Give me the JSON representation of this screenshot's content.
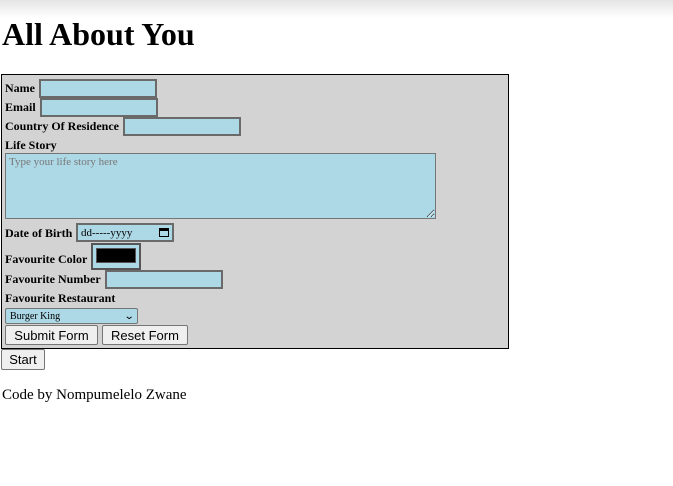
{
  "page": {
    "title": "All About You",
    "footer": "Code by Nompumelelo Zwane"
  },
  "form": {
    "name_label": "Name",
    "email_label": "Email",
    "country_label": "Country Of Residence",
    "life_story_label": "Life Story",
    "life_story_placeholder": "Type your life story here",
    "dob_label": "Date of Birth",
    "dob_value": "dd-----yyyy",
    "color_label": "Favourite Color",
    "color_value": "#000000",
    "number_label": "Favourite Number",
    "restaurant_label": "Favourite Restaurant",
    "restaurant_selected": "Burger King",
    "submit_label": "Submit Form",
    "reset_label": "Reset Form"
  },
  "start_label": "Start",
  "colors": {
    "form_background": "#d3d3d3",
    "field_background": "#add8e6"
  }
}
